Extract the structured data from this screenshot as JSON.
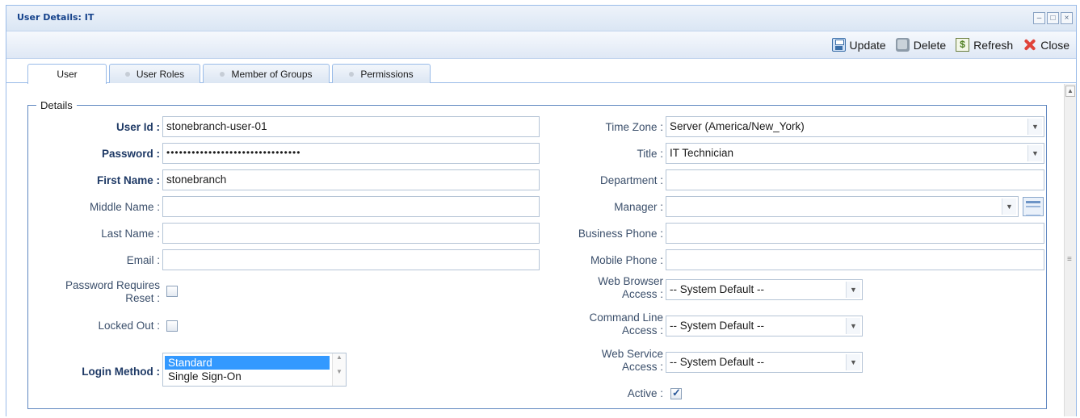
{
  "window": {
    "title": "User Details: IT",
    "controls": [
      "–",
      "□",
      "×"
    ]
  },
  "toolbar": {
    "update_label": "Update",
    "delete_label": "Delete",
    "refresh_label": "Refresh",
    "close_label": "Close"
  },
  "tabs": [
    {
      "label": "User"
    },
    {
      "label": "User Roles"
    },
    {
      "label": "Member of Groups"
    },
    {
      "label": "Permissions"
    }
  ],
  "details": {
    "legend": "Details",
    "left": {
      "user_id": {
        "label": "User Id :",
        "value": "stonebranch-user-01"
      },
      "password": {
        "label": "Password :",
        "value": "••••••••••••••••••••••••••••••••"
      },
      "first_name": {
        "label": "First Name :",
        "value": "stonebranch"
      },
      "middle_name": {
        "label": "Middle Name :",
        "value": ""
      },
      "last_name": {
        "label": "Last Name :",
        "value": ""
      },
      "email": {
        "label": "Email :",
        "value": ""
      },
      "password_reset": {
        "label_line1": "Password Requires",
        "label_line2": "Reset :",
        "checked": false
      },
      "locked_out": {
        "label": "Locked Out :",
        "checked": false
      },
      "login_method": {
        "label": "Login Method :",
        "options": [
          "Standard",
          "Single Sign-On"
        ],
        "selected": "Standard"
      }
    },
    "right": {
      "time_zone": {
        "label": "Time Zone :",
        "value": "Server (America/New_York)"
      },
      "title": {
        "label": "Title :",
        "value": "IT Technician"
      },
      "department": {
        "label": "Department :",
        "value": ""
      },
      "manager": {
        "label": "Manager :",
        "value": ""
      },
      "business_phone": {
        "label": "Business Phone :",
        "value": ""
      },
      "mobile_phone": {
        "label": "Mobile Phone :",
        "value": ""
      },
      "web_browser_access": {
        "label_line1": "Web Browser",
        "label_line2": "Access :",
        "value": "-- System Default --"
      },
      "command_line_access": {
        "label_line1": "Command Line",
        "label_line2": "Access :",
        "value": "-- System Default --"
      },
      "web_service_access": {
        "label_line1": "Web Service",
        "label_line2": "Access :",
        "value": "-- System Default --"
      },
      "active": {
        "label": "Active :",
        "checked": true
      }
    }
  },
  "colors": {
    "accent": "#15428b",
    "border": "#99bbe8",
    "selection": "#3399ff"
  }
}
